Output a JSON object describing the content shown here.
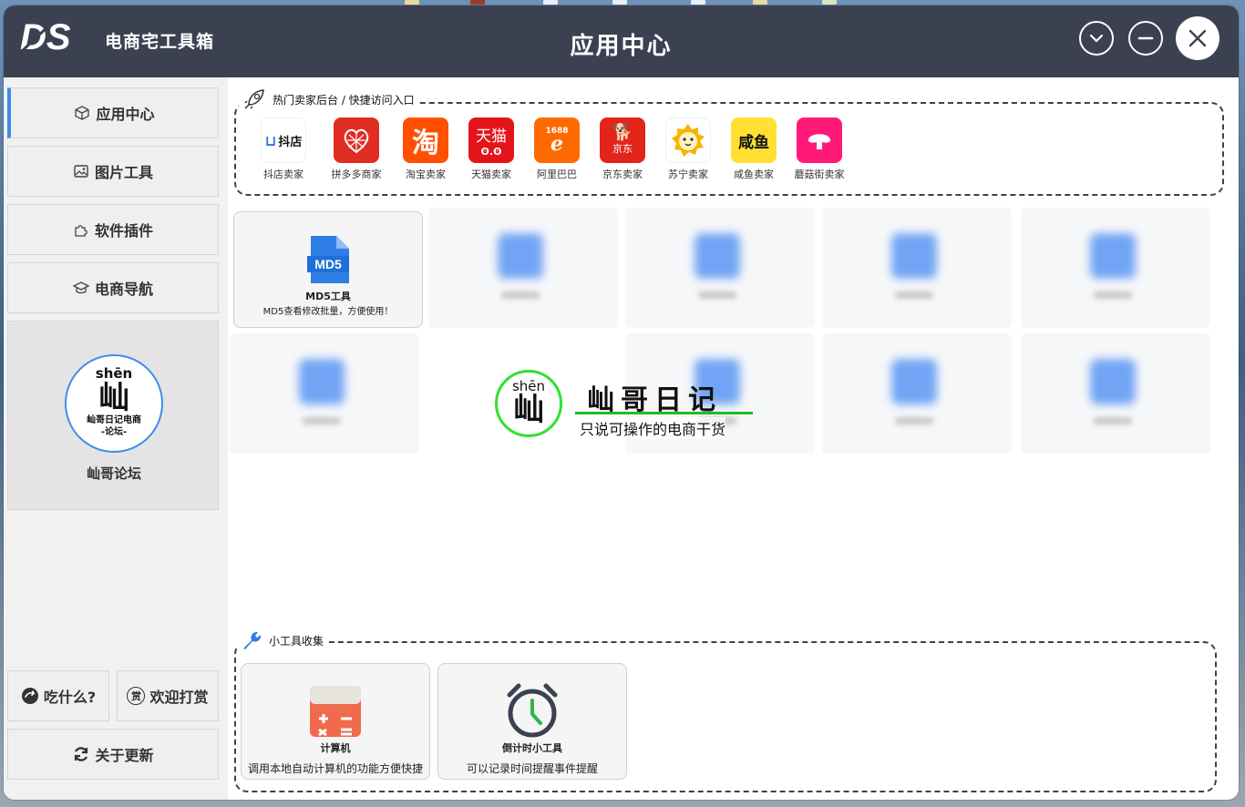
{
  "app": {
    "brand_logo_text": "DS",
    "brand_name": "电商宅工具箱",
    "window_title": "应用中心"
  },
  "window_controls": [
    "chevron-down-icon",
    "minimize-icon",
    "close-icon"
  ],
  "sidebar": {
    "items": [
      {
        "label": "应用中心",
        "icon": "cube-icon",
        "active": true
      },
      {
        "label": "图片工具",
        "icon": "image-icon",
        "active": false
      },
      {
        "label": "软件插件",
        "icon": "puzzle-icon",
        "active": false
      },
      {
        "label": "电商导航",
        "icon": "graduation-cap-icon",
        "active": false
      }
    ],
    "forum": {
      "pinyin": "shēn",
      "glyph": "屾",
      "line1": "屾哥日记电商",
      "line2": "-论坛-",
      "label": "屾哥论坛"
    },
    "food_label": "吃什么?",
    "reward_label": "欢迎打赏",
    "reward_glyph": "赏",
    "update_label": "关于更新"
  },
  "hot_section": {
    "title": "热门卖家后台 / 快捷访问入口",
    "shops": [
      {
        "label": "抖店卖家",
        "icon_text": "抖店",
        "color": "#ffffff"
      },
      {
        "label": "拼多多商家",
        "icon_text": "",
        "color": "#e02e24"
      },
      {
        "label": "淘宝卖家",
        "icon_text": "淘",
        "color": "#ff5000"
      },
      {
        "label": "天猫卖家",
        "icon_text": "天猫",
        "color": "#e5141b"
      },
      {
        "label": "阿里巴巴",
        "icon_text": "1688",
        "color": "#ff6a00"
      },
      {
        "label": "京东卖家",
        "icon_text": "京东",
        "color": "#e1251b"
      },
      {
        "label": "苏宁卖家",
        "icon_text": "",
        "color": "#ffffff"
      },
      {
        "label": "咸鱼卖家",
        "icon_text": "咸鱼",
        "color": "#ffe033"
      },
      {
        "label": "蘑菇街卖家",
        "icon_text": "",
        "color": "#ff1a7a"
      }
    ]
  },
  "md5_tool": {
    "icon_text": "MD5",
    "name": "MD5工具",
    "desc": "MD5查看修改批量，方便使用！"
  },
  "watermark": {
    "pinyin": "shēn",
    "glyph": "屾",
    "title": "屾哥日记",
    "subtitle": "只说可操作的电商干货"
  },
  "tools_section": {
    "title": "小工具收集",
    "tools": [
      {
        "name": "计算机",
        "desc": "调用本地自动计算机的功能方便快捷",
        "icon": "calculator-icon"
      },
      {
        "name": "倒计时小工具",
        "desc": "可以记录时间提醒事件提醒",
        "icon": "alarm-clock-icon"
      }
    ]
  },
  "colors": {
    "titlebar": "#3c4152",
    "accent": "#3b8fe8",
    "watermark_green": "#2ee32e"
  }
}
